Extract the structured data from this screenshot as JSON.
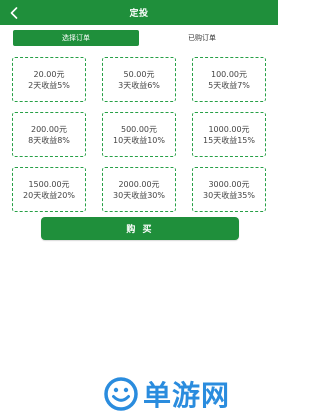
{
  "header": {
    "title": "定投",
    "back_icon": "chevron-left-icon"
  },
  "tabs": [
    {
      "label": "选择订单",
      "active": true
    },
    {
      "label": "已购订单",
      "active": false
    }
  ],
  "plans": [
    {
      "amount": "20.00元",
      "yield": "2天收益5%"
    },
    {
      "amount": "50.00元",
      "yield": "3天收益6%"
    },
    {
      "amount": "100.00元",
      "yield": "5天收益7%"
    },
    {
      "amount": "200.00元",
      "yield": "8天收益8%"
    },
    {
      "amount": "500.00元",
      "yield": "10天收益10%"
    },
    {
      "amount": "1000.00元",
      "yield": "15天收益15%"
    },
    {
      "amount": "1500.00元",
      "yield": "20天收益20%"
    },
    {
      "amount": "2000.00元",
      "yield": "30天收益30%"
    },
    {
      "amount": "3000.00元",
      "yield": "30天收益35%"
    }
  ],
  "buy_button": {
    "label": "购 买"
  },
  "watermark": {
    "text": "单游网",
    "suffix": ".com",
    "logo_icon": "smiley-logo-icon"
  },
  "colors": {
    "primary": "#1f8f3b",
    "card_border": "#27a046",
    "text": "#444444",
    "watermark": "#2a8cde"
  }
}
